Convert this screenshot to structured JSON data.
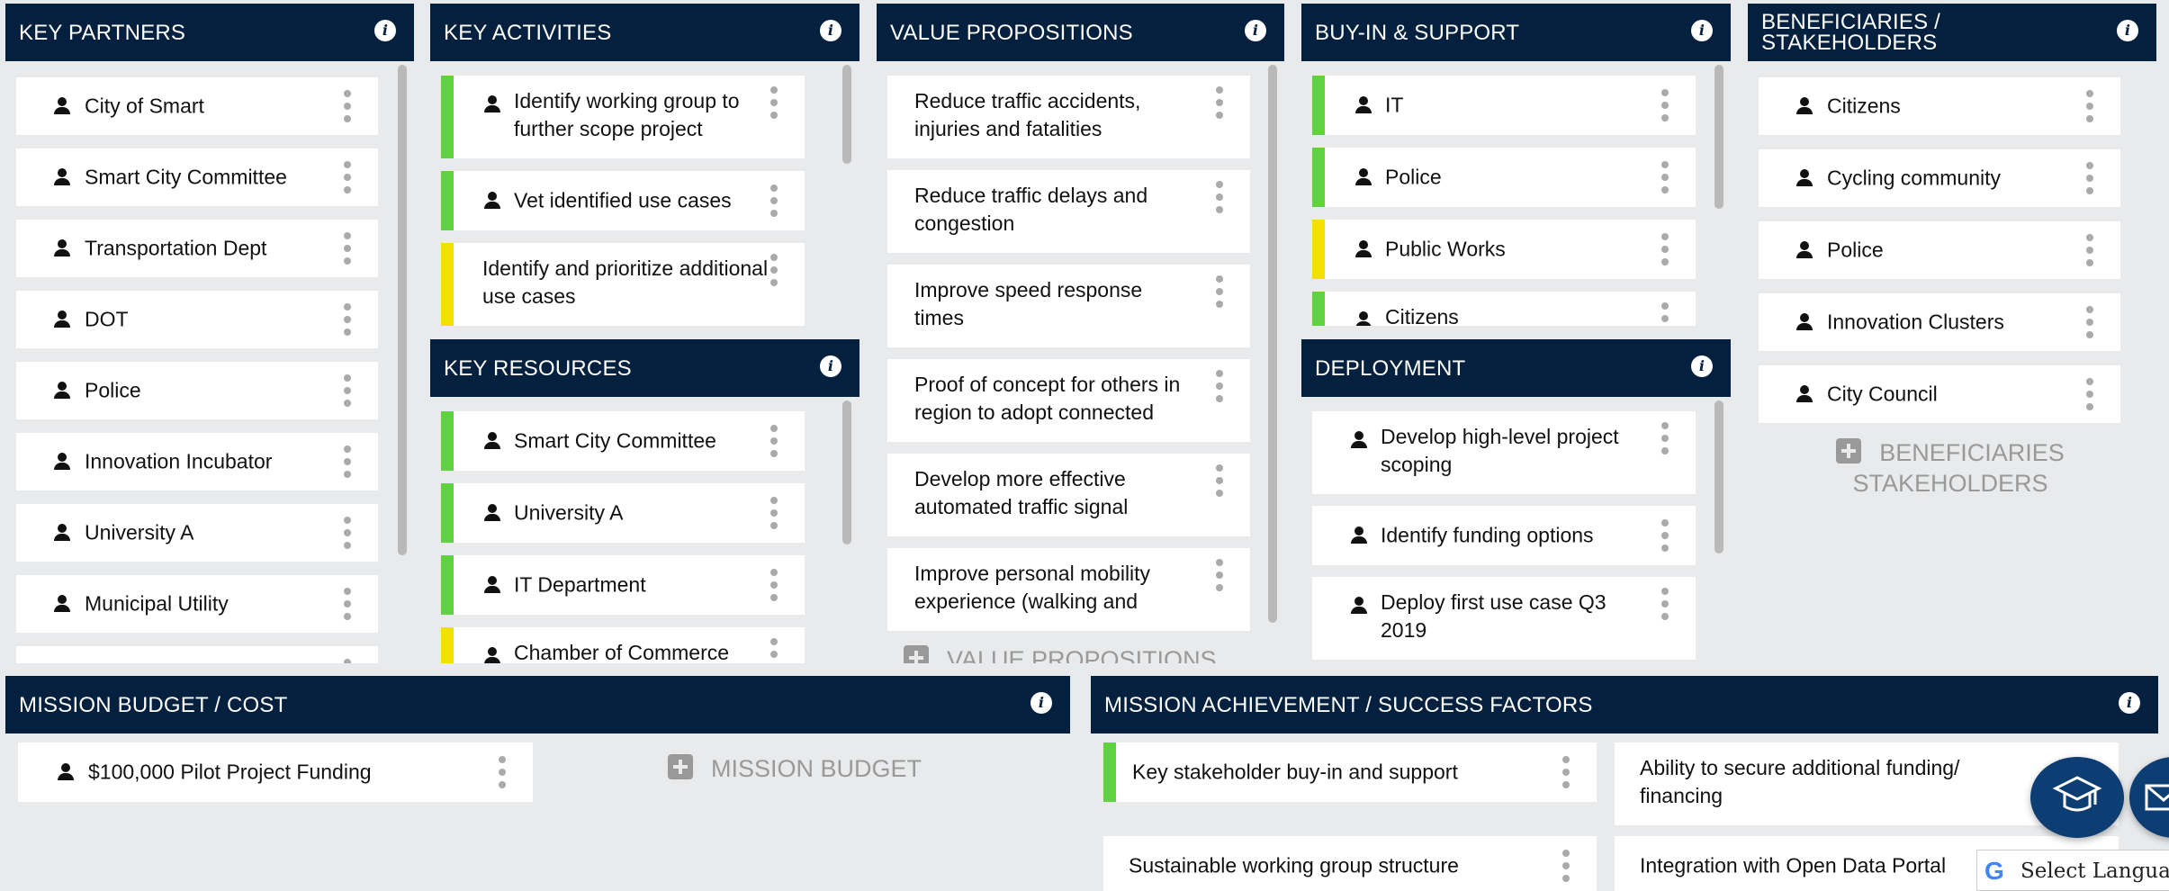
{
  "panels": {
    "key_partners": {
      "title": "KEY PARTNERS",
      "cards": [
        "City of Smart",
        "Smart City Committee",
        "Transportation Dept",
        "DOT",
        "Police",
        "Innovation Incubator",
        "University A",
        "Municipal Utility"
      ]
    },
    "key_activities": {
      "title": "KEY ACTIVITIES",
      "cards": [
        "Identify working group to further scope project",
        "Vet identified use cases",
        "Identify and prioritize additional use cases"
      ]
    },
    "key_resources": {
      "title": "KEY RESOURCES",
      "cards": [
        "Smart City Committee",
        "University A",
        "IT Department",
        "Chamber of Commerce"
      ]
    },
    "value_propositions": {
      "title": "VALUE PROPOSITIONS",
      "cards": [
        "Reduce traffic accidents, injuries and fatalities",
        "Reduce traffic delays and congestion",
        "Improve speed response times",
        "Proof of concept for others in region to adopt connected",
        "Develop more effective automated traffic signal",
        "Improve personal mobility experience (walking and"
      ],
      "add_label": "VALUE PROPOSITIONS"
    },
    "buy_in": {
      "title": "BUY-IN & SUPPORT",
      "cards": [
        "IT",
        "Police",
        "Public Works",
        "Citizens"
      ]
    },
    "deployment": {
      "title": "DEPLOYMENT",
      "cards": [
        "Develop high-level project scoping",
        "Identify funding options",
        "Deploy first use case Q3 2019"
      ]
    },
    "beneficiaries": {
      "title": "BENEFICIARIES / STAKEHOLDERS",
      "cards": [
        "Citizens",
        "Cycling community",
        "Police",
        "Innovation Clusters",
        "City Council"
      ],
      "add_label_1": "BENEFICIARIES",
      "add_label_2": "STAKEHOLDERS"
    },
    "mission_budget": {
      "title": "MISSION BUDGET / COST",
      "cards": [
        "$100,000 Pilot Project Funding"
      ],
      "add_label": "MISSION BUDGET"
    },
    "mission_achievement": {
      "title": "MISSION ACHIEVEMENT / SUCCESS FACTORS",
      "cards": [
        "Key stakeholder buy-in and support",
        "Ability to secure additional funding/ financing",
        "Sustainable working group structure",
        "Integration with Open Data Portal"
      ]
    }
  },
  "info_icon": "i",
  "language_selector": {
    "label": "Select Language",
    "icon": "google-g-icon"
  },
  "colors": {
    "header": "#04203f",
    "green": "#5fd33f",
    "yellow": "#f2e000",
    "background": "#e9eaec"
  }
}
